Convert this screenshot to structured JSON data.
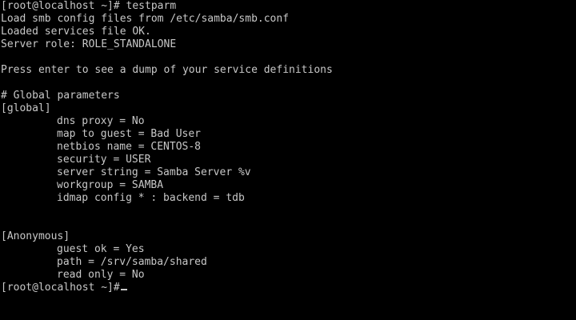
{
  "colors": {
    "background": "#000000",
    "foreground": "#c8c8c8"
  },
  "terminal": {
    "lines": [
      "[root@localhost ~]# testparm",
      "Load smb config files from /etc/samba/smb.conf",
      "Loaded services file OK.",
      "Server role: ROLE_STANDALONE",
      "",
      "Press enter to see a dump of your service definitions",
      "",
      "# Global parameters",
      "[global]",
      "dns proxy = No",
      "map to guest = Bad User",
      "netbios name = CENTOS-8",
      "security = USER",
      "server string = Samba Server %v",
      "workgroup = SAMBA",
      "idmap config * : backend = tdb",
      "",
      "",
      "[Anonymous]",
      "guest ok = Yes",
      "path = /srv/samba/shared",
      "read only = No",
      "[root@localhost ~]#"
    ]
  }
}
